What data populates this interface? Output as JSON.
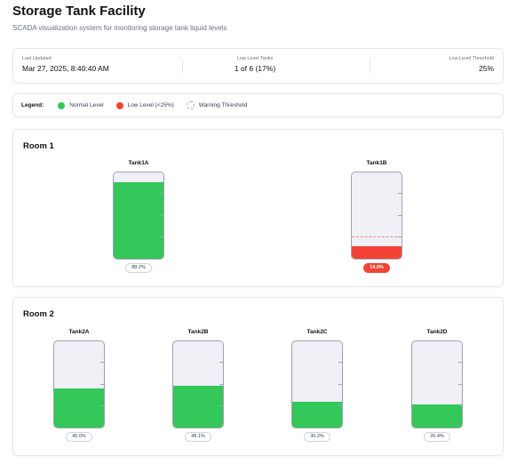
{
  "header": {
    "title": "Storage Tank Facility",
    "subtitle": "SCADA visualization system for monitoring storage tank liquid levels"
  },
  "stats": {
    "last_updated_label": "Last Updated",
    "last_updated_value": "Mar 27, 2025, 8:40:40 AM",
    "low_level_tanks_label": "Low Level Tanks",
    "low_level_tanks_value": "1 of 6 (17%)",
    "threshold_label": "Low Level Threshold",
    "threshold_value": "25%"
  },
  "legend": {
    "title": "Legend:",
    "normal": "Normal Level",
    "low": "Low Level (<25%)",
    "warning": "Warning Threshold"
  },
  "colors": {
    "normal": "#34c759",
    "low": "#f44336",
    "threshold": "#f08a7a"
  },
  "threshold_level": 0.25,
  "rooms": [
    {
      "title": "Room 1",
      "tanks": [
        {
          "name": "Tank1A",
          "level": 0.882,
          "label": "88.2%",
          "status": "normal"
        },
        {
          "name": "Tank1B",
          "level": 0.14,
          "label": "14.0%",
          "status": "low"
        }
      ]
    },
    {
      "title": "Room 2",
      "tanks": [
        {
          "name": "Tank2A",
          "level": 0.45,
          "label": "45.0%",
          "status": "normal"
        },
        {
          "name": "Tank2B",
          "level": 0.481,
          "label": "48.1%",
          "status": "normal"
        },
        {
          "name": "Tank2C",
          "level": 0.302,
          "label": "30.2%",
          "status": "normal"
        },
        {
          "name": "Tank2D",
          "level": 0.264,
          "label": "26.4%",
          "status": "normal"
        }
      ]
    }
  ]
}
